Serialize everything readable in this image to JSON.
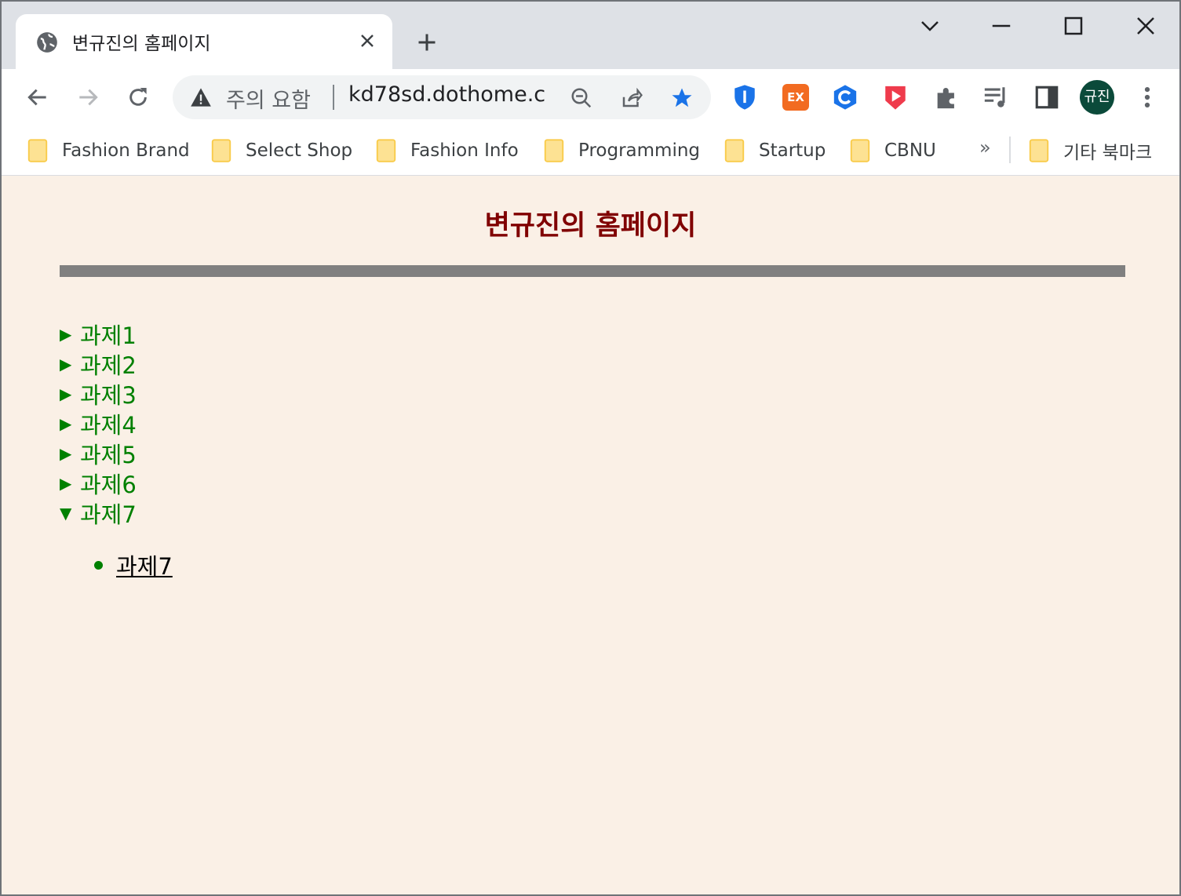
{
  "browser": {
    "tab_title": "변규진의 홈페이지",
    "security_label": "주의 요함",
    "url": "kd78sd.dothome.c...",
    "profile_name": "규진",
    "extension_ex_label": "EX",
    "bookmarks": [
      "Fashion Brand",
      "Select Shop",
      "Fashion Info",
      "Programming",
      "Startup",
      "CBNU"
    ],
    "bookmarks_more": "»",
    "other_bookmarks": "기타 북마크"
  },
  "page": {
    "title": "변규진의 홈페이지",
    "items": [
      {
        "arrow": "▶",
        "label": "과제1"
      },
      {
        "arrow": "▶",
        "label": "과제2"
      },
      {
        "arrow": "▶",
        "label": "과제3"
      },
      {
        "arrow": "▶",
        "label": "과제4"
      },
      {
        "arrow": "▶",
        "label": "과제5"
      },
      {
        "arrow": "▶",
        "label": "과제6"
      },
      {
        "arrow": "▼",
        "label": "과제7"
      }
    ],
    "subitem": "과제7"
  },
  "colors": {
    "page_background": "#faf0e6",
    "title_color": "#800000",
    "item_color": "#008000",
    "rule_color": "#808080"
  }
}
